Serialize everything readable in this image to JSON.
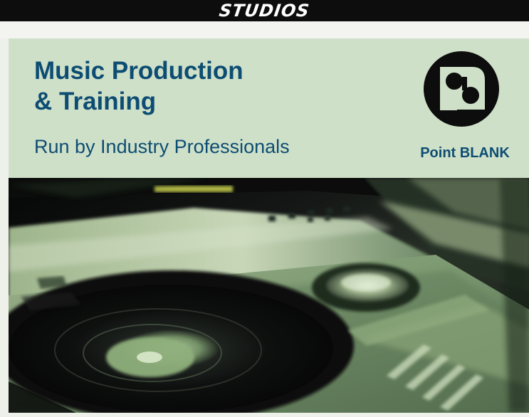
{
  "header": {
    "section_title": "STUDIOS"
  },
  "promo": {
    "headline_line_1": "Music Production",
    "headline_line_2": "& Training",
    "subhead": "Run by Industry Professionals",
    "logo_label": "Point BLANK"
  },
  "colors": {
    "background": "#eef1ea",
    "panel": "#cfe0c8",
    "text_blue": "#0d4d73",
    "black_bar": "#0d0d0d"
  },
  "image": {
    "subject": "dj-turntable-photo"
  }
}
